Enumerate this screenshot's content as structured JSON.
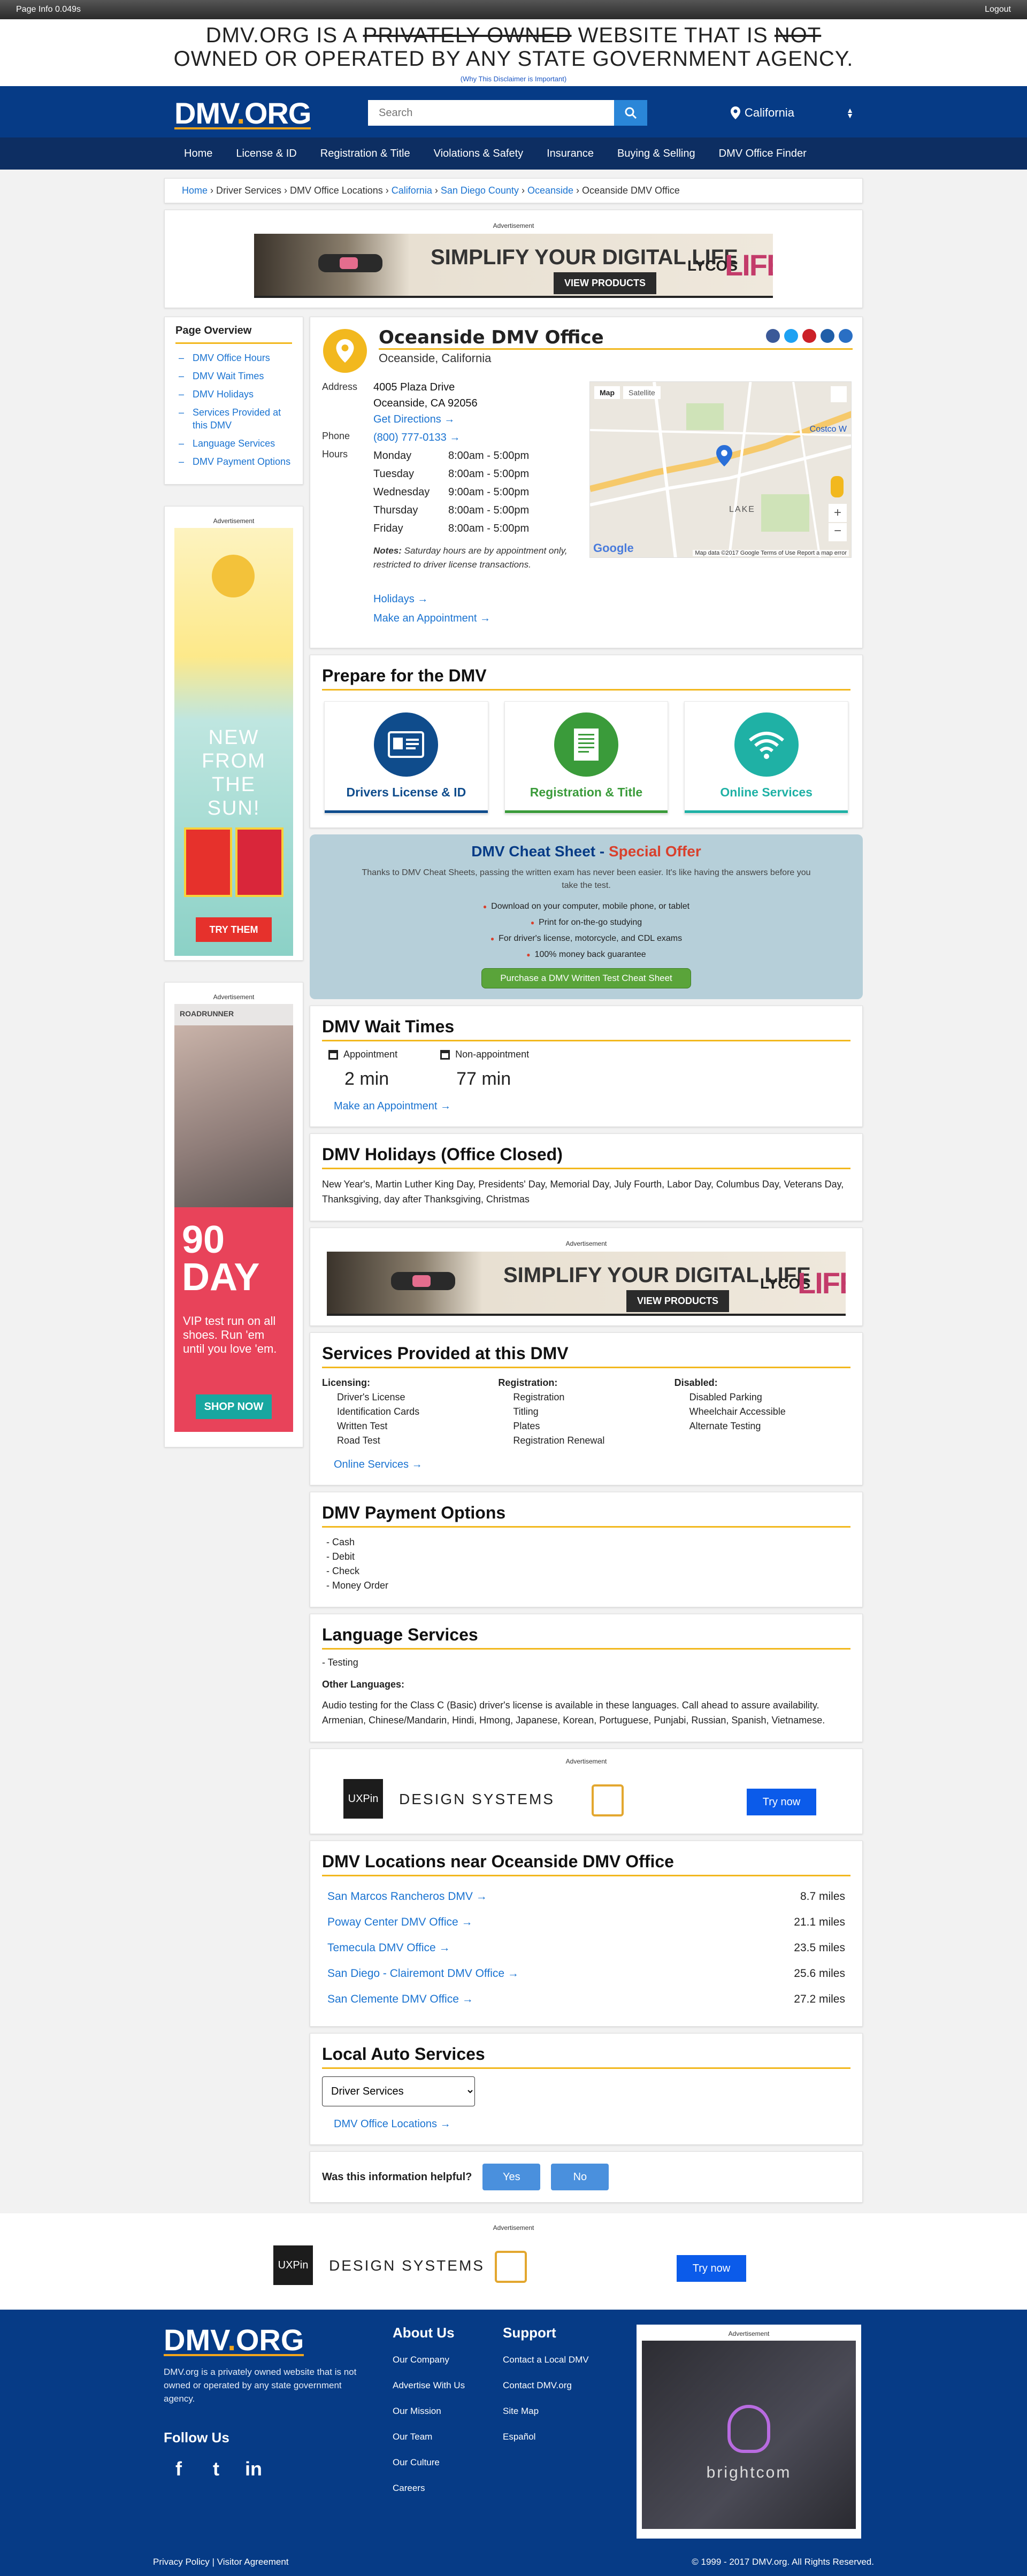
{
  "topbar": {
    "page_info": "Page Info 0.049s",
    "logout": "Logout"
  },
  "disclaimer": {
    "part1": "DMV.ORG IS A ",
    "part_strike": "PRIVATELY OWNED",
    "part2": " WEBSITE THAT IS ",
    "part_strike2": "NOT",
    "line2": "OWNED OR OPERATED BY ANY STATE GOVERNMENT AGENCY.",
    "why": "(Why This Disclaimer is Important)"
  },
  "header": {
    "logo_main": "DMV",
    "logo_dot": ".",
    "logo_tail": "ORG",
    "search_placeholder": "Search",
    "state": "California"
  },
  "nav": [
    "Home",
    "License & ID",
    "Registration & Title",
    "Violations & Safety",
    "Insurance",
    "Buying & Selling",
    "DMV Office Finder"
  ],
  "breadcrumb": {
    "items": [
      "Home",
      "Driver Services",
      "DMV Office Locations",
      "California",
      "San Diego County",
      "Oceanside",
      "Oceanside DMV Office"
    ],
    "sep": " › "
  },
  "ads": {
    "label": "Advertisement",
    "banner_title": "SIMPLIFY YOUR DIGITAL LIFE",
    "banner_cta": "VIEW PRODUCTS",
    "banner_brand1": "LYCOS",
    "banner_brand2": "LIFE",
    "side1_text": "NEW FROM THE SUN!",
    "side1_cta": "TRY THEM",
    "side2_brand": "ROADRUNNER",
    "side2_big1": "90",
    "side2_big2": "DAY",
    "side2_text": "VIP test run on all shoes. Run 'em until you love 'em.",
    "side2_cta": "SHOP NOW",
    "ux_logo": "UXPin",
    "ux_text": "DESIGN SYSTEMS",
    "ux_cta": "Try now",
    "footer_ad_brand": "brightcom"
  },
  "overview": {
    "title": "Page Overview",
    "links": [
      "DMV Office Hours",
      "DMV Wait Times",
      "DMV Holidays",
      "Services Provided at this DMV",
      "Language Services",
      "DMV Payment Options"
    ]
  },
  "office": {
    "name": "Oceanside DMV Office",
    "city": "Oceanside, California",
    "address_label": "Address",
    "address1": "4005 Plaza Drive",
    "address2": "Oceanside, CA 92056",
    "directions": "Get Directions →",
    "phone_label": "Phone",
    "phone": "(800) 777-0133 →",
    "hours_label": "Hours",
    "hours": [
      {
        "day": "Monday",
        "time": "8:00am - 5:00pm"
      },
      {
        "day": "Tuesday",
        "time": "8:00am - 5:00pm"
      },
      {
        "day": "Wednesday",
        "time": "9:00am - 5:00pm"
      },
      {
        "day": "Thursday",
        "time": "8:00am - 5:00pm"
      },
      {
        "day": "Friday",
        "time": "8:00am - 5:00pm"
      }
    ],
    "note_bold": "Notes:",
    "note": " Saturday hours are by appointment only, restricted to driver license transactions.",
    "holidays_link": "Holidays →",
    "appt_link": "Make an Appointment →",
    "map_tab1": "Map",
    "map_tab2": "Satellite",
    "map_footer": "Map data ©2017 Google   Terms of Use   Report a map error",
    "map_label_costco": "Costco W",
    "map_label_lake": "LAKE"
  },
  "prepare": {
    "title": "Prepare for the DMV",
    "tiles": [
      {
        "label": "Drivers License & ID",
        "color": "#0f4c8c"
      },
      {
        "label": "Registration & Title",
        "color": "#3a9b3a"
      },
      {
        "label": "Online Services",
        "color": "#1fb1a5"
      }
    ]
  },
  "cheat": {
    "title": "DMV Cheat Sheet - ",
    "title_red": "Special Offer",
    "desc": "Thanks to DMV Cheat Sheets, passing the written exam has never been easier. It's like having the answers before you take the test.",
    "bullets": [
      "Download on your computer, mobile phone, or tablet",
      "Print for on-the-go studying",
      "For driver's license, motorcycle, and CDL exams",
      "100% money back guarantee"
    ],
    "button": "Purchase a DMV Written Test Cheat Sheet"
  },
  "wait": {
    "title": "DMV Wait Times",
    "appt_label": "Appointment",
    "appt_value": "2 min",
    "nonappt_label": "Non-appointment",
    "nonappt_value": "77 min",
    "link": "Make an Appointment →"
  },
  "holidays": {
    "title": "DMV Holidays (Office Closed)",
    "text": "New Year's, Martin Luther King Day, Presidents' Day, Memorial Day, July Fourth, Labor Day, Columbus Day, Veterans Day, Thanksgiving, day after Thanksgiving, Christmas"
  },
  "services": {
    "title": "Services Provided at this DMV",
    "columns": [
      {
        "head": "Licensing:",
        "items": [
          "Driver's License",
          "Identification Cards",
          "Written Test",
          "Road Test"
        ]
      },
      {
        "head": "Registration:",
        "items": [
          "Registration",
          "Titling",
          "Plates",
          "Registration Renewal"
        ]
      },
      {
        "head": "Disabled:",
        "items": [
          "Disabled Parking",
          "Wheelchair Accessible",
          "Alternate Testing"
        ]
      }
    ],
    "link": "Online Services →"
  },
  "payment": {
    "title": "DMV Payment Options",
    "items": [
      "- Cash",
      "- Debit",
      "- Check",
      "- Money Order"
    ]
  },
  "language": {
    "title": "Language Services",
    "item": "- Testing",
    "other_head": "Other Languages:",
    "other_text": "Audio testing for the Class C (Basic) driver's license is available in these languages. Call ahead to assure availability. Armenian, Chinese/Mandarin, Hindi, Hmong, Japanese, Korean, Portuguese, Punjabi, Russian, Spanish, Vietnamese."
  },
  "nearby": {
    "title": "DMV Locations near Oceanside DMV Office",
    "rows": [
      {
        "name": "San Marcos Rancheros DMV →",
        "dist": "8.7 miles"
      },
      {
        "name": "Poway Center DMV Office →",
        "dist": "21.1 miles"
      },
      {
        "name": "Temecula DMV Office →",
        "dist": "23.5 miles"
      },
      {
        "name": "San Diego - Clairemont DMV Office →",
        "dist": "25.6 miles"
      },
      {
        "name": "San Clemente DMV Office →",
        "dist": "27.2 miles"
      }
    ]
  },
  "auto": {
    "title": "Local Auto Services",
    "select_value": "Driver Services",
    "link": "DMV Office Locations →"
  },
  "helpful": {
    "question": "Was this information helpful?",
    "yes": "Yes",
    "no": "No"
  },
  "footer": {
    "blurb": "DMV.org is a privately owned website that is not owned or operated by any state government agency.",
    "follow": "Follow Us",
    "about_head": "About Us",
    "about_links": [
      "Our Company",
      "Advertise With Us",
      "Our Mission",
      "Our Team",
      "Our Culture",
      "Careers"
    ],
    "support_head": "Support",
    "support_links": [
      "Contact a Local DMV",
      "Contact DMV.org",
      "Site Map",
      "Español"
    ],
    "bottom_left": "Privacy Policy | Visitor Agreement",
    "bottom_right": "© 1999 - 2017 DMV.org. All Rights Reserved."
  }
}
